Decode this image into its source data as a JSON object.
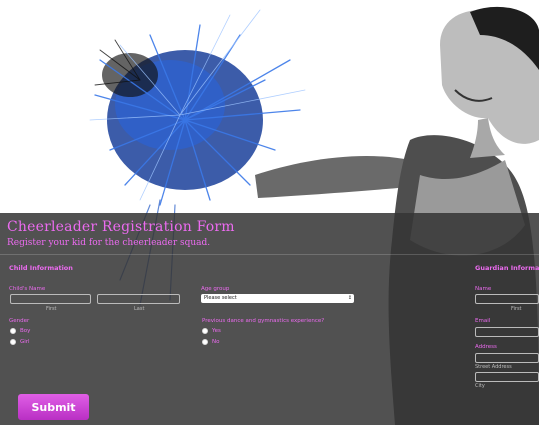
{
  "form": {
    "title": "Cheerleader Registration Form",
    "subtitle": "Register your kid for the cheerleader squad.",
    "submit_label": "Submit"
  },
  "child": {
    "section_title": "Child Information",
    "name_label": "Child's Name",
    "first_sub": "First",
    "last_sub": "Last",
    "age_label": "Age group",
    "age_selected": "Please select",
    "gender_label": "Gender",
    "gender_options": [
      "Boy",
      "Girl"
    ],
    "experience_label": "Previous dance and gymnastics experience?",
    "experience_options": [
      "Yes",
      "No"
    ]
  },
  "guardian": {
    "section_title": "Guardian Informat",
    "name_label": "Name",
    "first_sub": "First",
    "email_label": "Email",
    "address_label": "Address",
    "street_sub": "Street Address",
    "city_sub": "City"
  },
  "colors": {
    "accent": "#ec6bf0",
    "panel": "#343434",
    "button": "#c93fd4"
  },
  "hero_image": {
    "icon": "cheerleader-with-pompom-photo"
  }
}
